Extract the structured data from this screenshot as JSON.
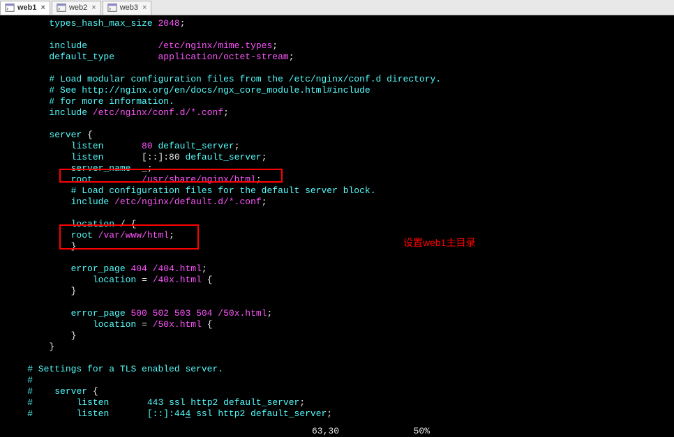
{
  "tabs": [
    {
      "label": "web1",
      "active": true
    },
    {
      "label": "web2",
      "active": false
    },
    {
      "label": "web3",
      "active": false
    }
  ],
  "close_glyph": "×",
  "code": {
    "l1a": "types_hash_max_size",
    "l1b": "2048",
    "l2a": "include",
    "l2b": "/etc/nginx/mime.types",
    "l3a": "default_type",
    "l3b": "application/octet-stream",
    "l4a": "# Load modular configuration files from the /etc/nginx/conf.d directory.",
    "l4b": "# See http://nginx.org/en/docs/ngx_core_module.html#include",
    "l4c": "# for more information.",
    "l5a": "include",
    "l5b": "/etc/nginx/conf.d/*.conf",
    "l6a": "server",
    "l6b": "{",
    "l7a": "listen",
    "l7b": "80",
    "l7c": "default_server",
    "l8a": "listen",
    "l8b": "[::]:80",
    "l8c": "default_server",
    "l9a": "server_name",
    "l9b": "_",
    "l10a": "root",
    "l10b": "/usr/share/nginx/html",
    "l11a": "# Load configuration files for the default server block.",
    "l12a": "include",
    "l12b": "/etc/nginx/default.d/*.conf",
    "l13a": "location",
    "l13b": "/",
    "l13c": "{",
    "l14a": "root",
    "l14b": "/var/www/html",
    "l15a": "}",
    "l16a": "error_page",
    "l16b": "404",
    "l16c": "/404.html",
    "l17a": "location",
    "l17b": "=",
    "l17c": "/40x.html",
    "l17d": "{",
    "l18a": "}",
    "l19a": "error_page",
    "l19b": "500 502 503 504",
    "l19c": "/50x.html",
    "l20a": "location",
    "l20b": "=",
    "l20c": "/50x.html",
    "l20d": "{",
    "l21a": "}",
    "l22a": "}",
    "l23a": "# Settings for a TLS enabled server.",
    "l23b": "#",
    "l24a": "#",
    "l24b": "server",
    "l24c": "{",
    "l25a": "#",
    "l25b": "listen",
    "l25c": "443",
    "l25d": "ssl http2 default_server",
    "l26a": "#",
    "l26b": "listen",
    "l26c": "[::]:44",
    "l26cu": "4",
    "l26d": "ssl http2 default_server"
  },
  "annotation": "设置web1主目录",
  "status": {
    "position": "63,30",
    "percent": "50%"
  }
}
